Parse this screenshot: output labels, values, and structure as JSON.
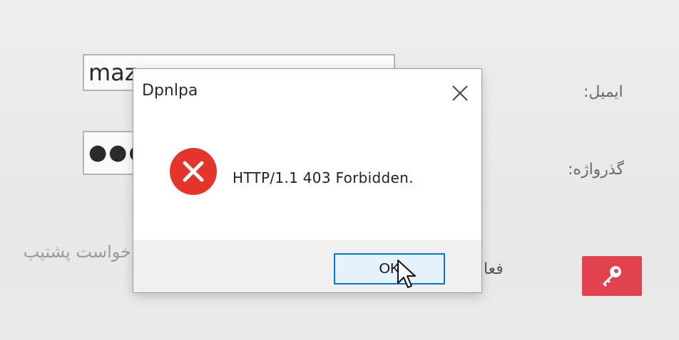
{
  "form": {
    "email_value": "maz",
    "password_value": "●●●",
    "email_label": "ایمیل:",
    "password_label": "گذرواژه:",
    "support_text": "خواست پشتیب",
    "active_text": "فعال"
  },
  "dialog": {
    "title": "Dpnlpa",
    "message": "HTTP/1.1 403 Forbidden.",
    "ok_label": "OK",
    "icon": "error-icon"
  },
  "colors": {
    "key_button": "#e2424e",
    "error_red": "#e4352b",
    "ok_border": "#0078d7"
  }
}
